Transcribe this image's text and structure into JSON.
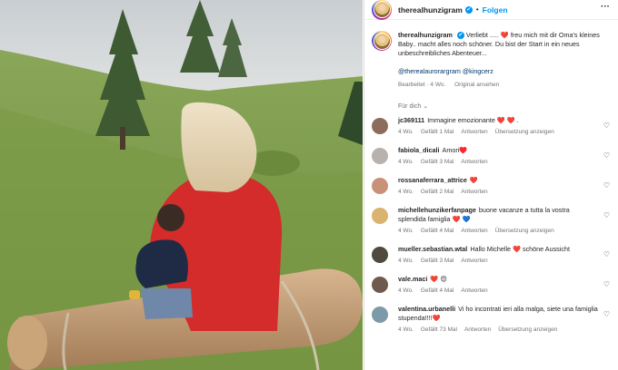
{
  "post": {
    "username": "therealhunzigram",
    "follow_label": "Folgen",
    "more_label": "···",
    "verified_icon": "✔",
    "caption_user": "therealhunzigram",
    "caption_text": "Verliebt ..... ❤️ freu mich mit dir Oma's kleines Baby.. macht alles noch schöner. Du bist der Start in ein neues unbeschreibliches Abenteuer...",
    "mentions": [
      "@therealaurorargram",
      "@kingcerz"
    ],
    "edited": "Bearbeitet · 4 Wo.",
    "see_original": "Original ansehen",
    "for_you": "Für dich ⌄"
  },
  "comments": [
    {
      "user": "jc369111",
      "text": "Immagine emozionante ❤️ ❤️ .",
      "time": "4 Wo.",
      "likes": "Gefällt 1 Mal",
      "reply": "Antworten",
      "translate": "Übersetzung anzeigen",
      "avatar_color": "#8c6d5c"
    },
    {
      "user": "fabiola_dicali",
      "text": "Amori♥️",
      "time": "4 Wo.",
      "likes": "Gefällt 3 Mal",
      "reply": "Antworten",
      "translate": "",
      "avatar_color": "#b7b2ad"
    },
    {
      "user": "rossanaferrara_attrice",
      "text": "❤️",
      "time": "4 Wo.",
      "likes": "Gefällt 2 Mal",
      "reply": "Antworten",
      "translate": "",
      "avatar_color": "#c9917a"
    },
    {
      "user": "michellehunzikerfanpage",
      "text": "buone vacanze a tutta la vostra splendida famiglia ❤️ 💙",
      "time": "4 Wo.",
      "likes": "Gefällt 4 Mal",
      "reply": "Antworten",
      "translate": "Übersetzung anzeigen",
      "avatar_color": "#d9b36f"
    },
    {
      "user": "mueller.sebastian.wtal",
      "text": "Hallo Michelle ❤️ schöne Aussicht",
      "time": "4 Wo.",
      "likes": "Gefällt 3 Mal",
      "reply": "Antworten",
      "translate": "",
      "avatar_color": "#4f4a3d"
    },
    {
      "user": "vale.maci",
      "text": "❤️ 😍",
      "time": "4 Wo.",
      "likes": "Gefällt 4 Mal",
      "reply": "Antworten",
      "translate": "",
      "avatar_color": "#6f5a4e"
    },
    {
      "user": "valentina.urbanelli",
      "text": "Vi ho incontrati ieri alla malga, siete una famiglia stupenda!!!!❤️",
      "time": "4 Wo.",
      "likes": "Gefällt 73 Mal",
      "reply": "Antworten",
      "translate": "Übersetzung anzeigen",
      "avatar_color": "#7c9aa8"
    }
  ],
  "icons": {
    "like": "♡",
    "options": "more-horizontal-icon"
  },
  "colors": {
    "link": "#0095f6",
    "mention": "#00376b",
    "meta": "#737373",
    "heart": "#ed4956"
  }
}
